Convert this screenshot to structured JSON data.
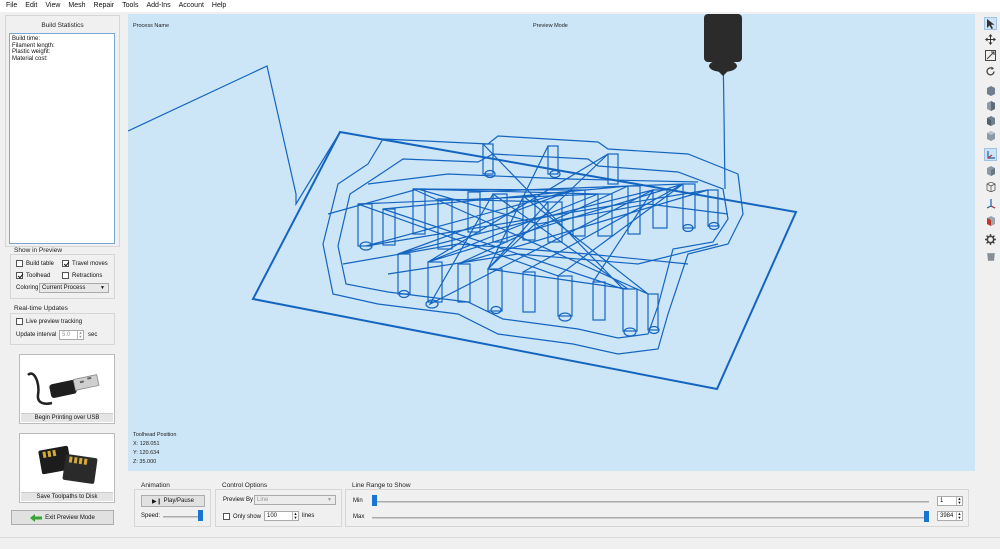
{
  "menu": [
    "File",
    "Edit",
    "View",
    "Mesh",
    "Repair",
    "Tools",
    "Add-Ins",
    "Account",
    "Help"
  ],
  "build_stats": {
    "title": "Build Statistics",
    "lines": [
      "Build time:",
      "Filament length:",
      "Plastic weight:",
      "Material cost:"
    ]
  },
  "show_in_preview": {
    "title": "Show in Preview",
    "build_table": {
      "label": "Build table",
      "checked": false
    },
    "travel_moves": {
      "label": "Travel moves",
      "checked": true
    },
    "toolhead": {
      "label": "Toolhead",
      "checked": true
    },
    "retractions": {
      "label": "Retractions",
      "checked": false
    },
    "coloring_label": "Coloring",
    "coloring_value": "Current Process"
  },
  "realtime": {
    "title": "Real-time Updates",
    "live_label": "Live preview tracking",
    "live_checked": false,
    "interval_label": "Update interval",
    "interval_value": "5.0",
    "interval_unit": "sec"
  },
  "usb_card": {
    "label": "Begin Printing over USB",
    "icon": "usb-cable-icon"
  },
  "sd_card": {
    "label": "Save Toolpaths to Disk",
    "icon": "sd-card-icon"
  },
  "exit_button": {
    "label": "Exit Preview Mode",
    "icon": "green-arrow-left-icon"
  },
  "viewport": {
    "process_name": "Process Name",
    "mode": "Preview Mode",
    "toolhead_title": "Toolhead Position",
    "x": "X: 128.051",
    "y": "Y: 120.634",
    "z": "Z: 35.000",
    "line_color": "#1565c0",
    "background": "#cce5f7"
  },
  "animation": {
    "title": "Animation",
    "play_label": "Play/Pause",
    "speed_label": "Speed:",
    "speed_level": 1.0
  },
  "control": {
    "title": "Control Options",
    "preview_by_label": "Preview By",
    "preview_by_value": "Line",
    "only_show_label": "Only show",
    "only_show_checked": false,
    "only_show_value": "100",
    "only_show_unit": "lines"
  },
  "line_range": {
    "title": "Line Range to Show",
    "min_label": "Min",
    "max_label": "Max",
    "min_value": "1",
    "max_value": "3984"
  },
  "right_tools": [
    "cursor-arrow-icon",
    "move-icon",
    "scale-icon",
    "rotate-icon",
    "view-front-icon",
    "view-back-icon",
    "view-left-icon",
    "view-right-icon",
    "axes-icon",
    "view-iso-icon",
    "wireframe-cube-icon",
    "axis-z-icon",
    "section-icon",
    "gear-icon",
    "bin-icon"
  ]
}
